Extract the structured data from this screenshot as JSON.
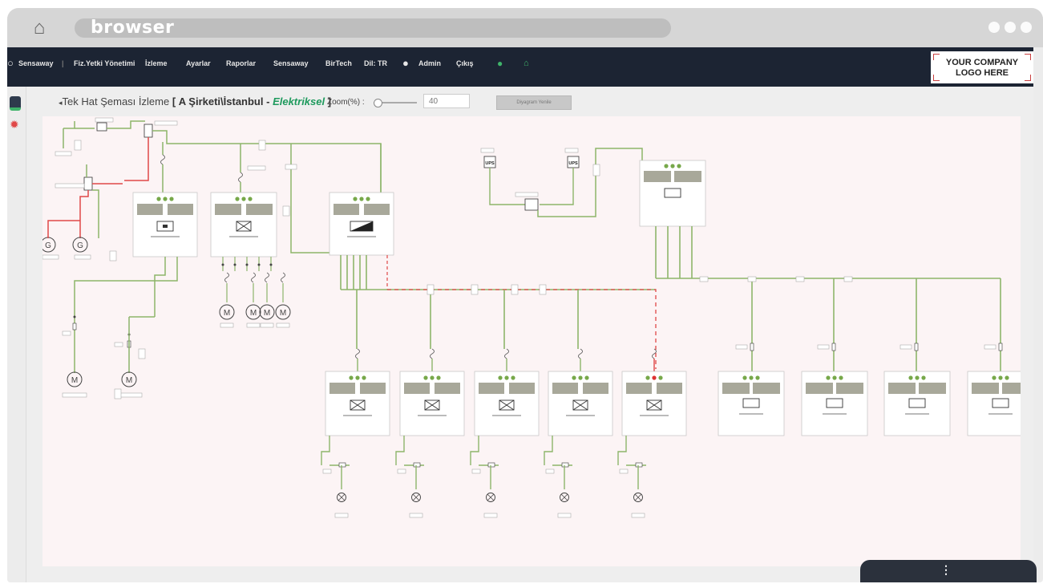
{
  "browser": {
    "title": "browser"
  },
  "nav": {
    "items": [
      "Sensaway",
      "Fiz.Yetki Yönetimi",
      "İzleme",
      "Ayarlar",
      "Raporlar",
      "Sensaway",
      "BirTech",
      "Dil: TR",
      "Admin",
      "Çıkış"
    ],
    "logo_line1": "YOUR COMPANY",
    "logo_line2": "LOGO HERE"
  },
  "page": {
    "title_prefix": "Tek Hat Şeması İzleme",
    "title_open": "[",
    "title_location": "A Şirketi\\İstanbul -",
    "title_type": "Elektriksel",
    "title_close": "]",
    "zoom_label": "Zoom(%) :",
    "zoom_value": "40",
    "diagram_button": "Diyagram Yenile"
  },
  "diagram": {
    "generator_symbol": "G",
    "motor_symbol": "M",
    "ups_label": "UPS",
    "colors": {
      "line": "#8db56a",
      "alarm": "#e04848",
      "panel": "#a8a89a",
      "led_ok": "#77a84a",
      "led_alarm": "#dd3333"
    }
  },
  "bottom": {
    "menu_icon": "⋮"
  }
}
